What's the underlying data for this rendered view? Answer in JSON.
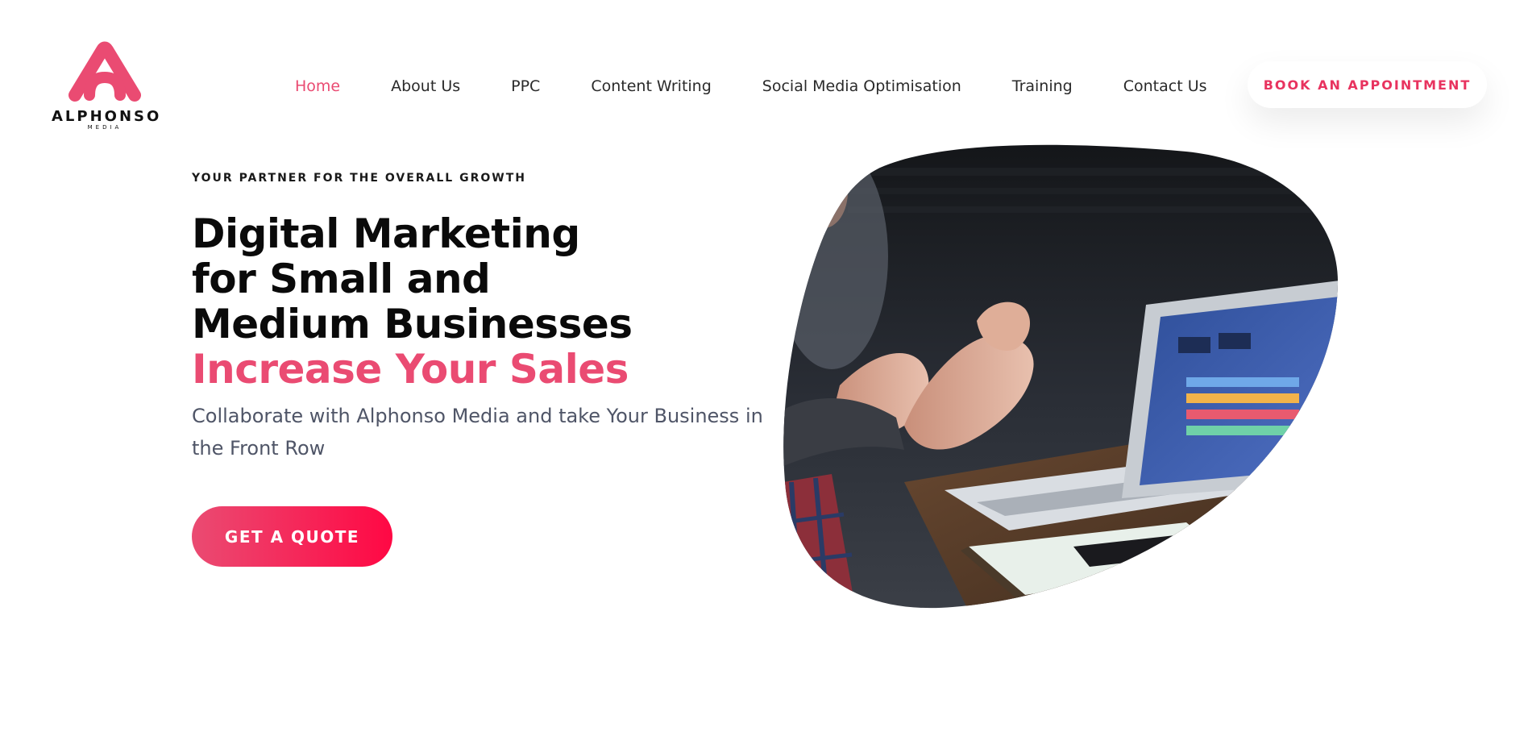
{
  "brand": {
    "name": "ALPHONSO",
    "sub": "MEDIA",
    "color": "#ea4b72"
  },
  "nav": {
    "items": [
      {
        "label": "Home",
        "active": true
      },
      {
        "label": "About Us",
        "active": false
      },
      {
        "label": "PPC",
        "active": false
      },
      {
        "label": "Content Writing",
        "active": false
      },
      {
        "label": "Social Media Optimisation",
        "active": false
      },
      {
        "label": "Training",
        "active": false
      },
      {
        "label": "Contact Us",
        "active": false
      }
    ],
    "cta_label": "BOOK AN APPOINTMENT"
  },
  "hero": {
    "eyebrow": "YOUR PARTNER FOR THE OVERALL GROWTH",
    "headline_lines": [
      "Digital Marketing",
      "for Small and",
      "Medium Businesses"
    ],
    "headline_accent": "Increase Your Sales",
    "subtext": "Collaborate with Alphonso Media and take Your Business in the Front Row",
    "cta_label": "GET A QUOTE",
    "image": "team-meeting-laptop-photo"
  },
  "colors": {
    "accent": "#ea4b72",
    "accent_strong": "#ff0844",
    "heading": "#0a0a0a",
    "body_text": "#4f5567"
  }
}
